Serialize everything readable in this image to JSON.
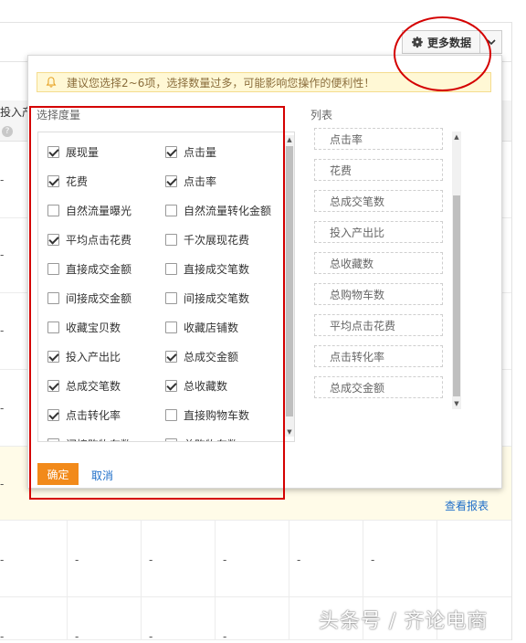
{
  "toolbar": {
    "more_data_label": "更多数据"
  },
  "background_table": {
    "header_label": "投入产",
    "help_mark": "?",
    "dash": "-",
    "report_link": "查看报表"
  },
  "panel": {
    "notice": "建议您选择2~6项，选择数量过多，可能影响您操作的便利性！",
    "metric_section_label": "选择度量",
    "list_section_label": "列表",
    "metrics": [
      {
        "label": "展现量",
        "checked": true
      },
      {
        "label": "点击量",
        "checked": true
      },
      {
        "label": "花费",
        "checked": true
      },
      {
        "label": "点击率",
        "checked": true
      },
      {
        "label": "自然流量曝光",
        "checked": false
      },
      {
        "label": "自然流量转化金额",
        "checked": false
      },
      {
        "label": "平均点击花费",
        "checked": true
      },
      {
        "label": "千次展现花费",
        "checked": false
      },
      {
        "label": "直接成交金额",
        "checked": false
      },
      {
        "label": "直接成交笔数",
        "checked": false
      },
      {
        "label": "间接成交金额",
        "checked": false
      },
      {
        "label": "间接成交笔数",
        "checked": false
      },
      {
        "label": "收藏宝贝数",
        "checked": false
      },
      {
        "label": "收藏店铺数",
        "checked": false
      },
      {
        "label": "投入产出比",
        "checked": true
      },
      {
        "label": "总成交金额",
        "checked": true
      },
      {
        "label": "总成交笔数",
        "checked": true
      },
      {
        "label": "总收藏数",
        "checked": true
      },
      {
        "label": "点击转化率",
        "checked": true
      },
      {
        "label": "直接购物车数",
        "checked": false
      },
      {
        "label": "间接购物车数",
        "checked": false
      },
      {
        "label": "总购物车数",
        "checked": true
      }
    ],
    "list_items": [
      "点击率",
      "花费",
      "总成交笔数",
      "投入产出比",
      "总收藏数",
      "总购物车数",
      "平均点击花费",
      "点击转化率",
      "总成交金额"
    ],
    "confirm_label": "确定",
    "cancel_label": "取消"
  },
  "watermark": "头条号 / 齐论电商",
  "colors": {
    "accent_orange": "#f28a1a",
    "link_blue": "#1f6fc9",
    "annotation_red": "#d40000",
    "notice_bg": "#fff8d5"
  }
}
